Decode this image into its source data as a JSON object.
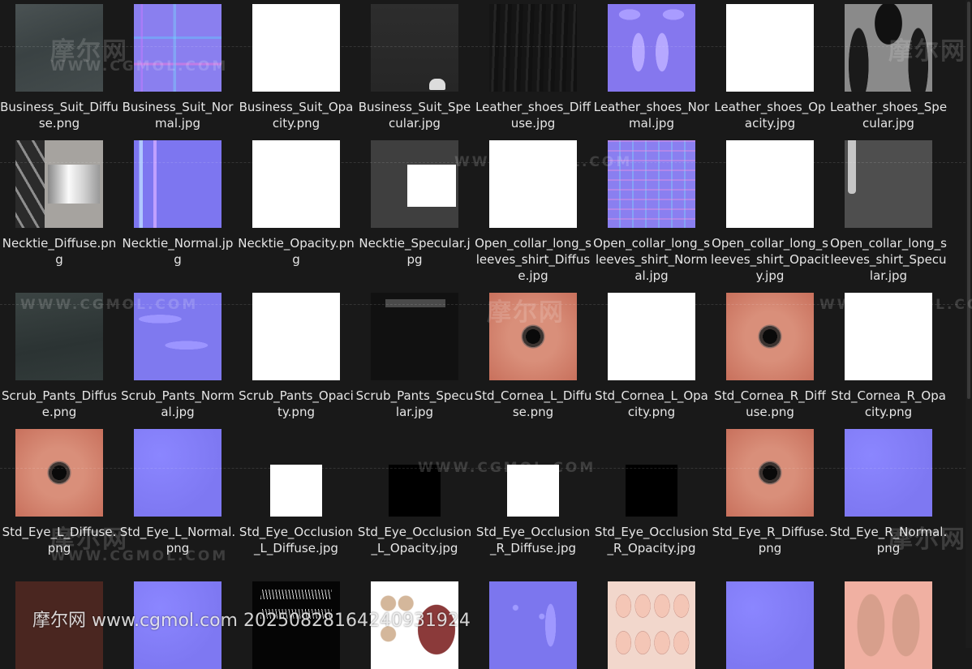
{
  "files": [
    {
      "name": "Business_Suit_Diffuse.png",
      "tex": "t-suit-diffuse",
      "icon": "texture-thumbnail"
    },
    {
      "name": "Business_Suit_Normal.jpg",
      "tex": "t-suit-normal",
      "icon": "texture-thumbnail"
    },
    {
      "name": "Business_Suit_Opacity.png",
      "tex": "t-white",
      "icon": "texture-thumbnail"
    },
    {
      "name": "Business_Suit_Specular.jpg",
      "tex": "t-suit-spec t-spec-dot",
      "icon": "texture-thumbnail"
    },
    {
      "name": "Leather_shoes_Diffuse.jpg",
      "tex": "t-shoe-diffuse",
      "icon": "texture-thumbnail"
    },
    {
      "name": "Leather_shoes_Normal.jpg",
      "tex": "t-shoe-normal",
      "icon": "texture-thumbnail"
    },
    {
      "name": "Leather_shoes_Opacity.jpg",
      "tex": "t-white",
      "icon": "texture-thumbnail"
    },
    {
      "name": "Leather_shoes_Specular.jpg",
      "tex": "t-shoe-spec",
      "icon": "texture-thumbnail"
    },
    {
      "name": "Necktie_Diffuse.png",
      "tex": "t-tie-diffuse",
      "icon": "texture-thumbnail"
    },
    {
      "name": "Necktie_Normal.jpg",
      "tex": "t-tie-normal",
      "icon": "texture-thumbnail"
    },
    {
      "name": "Necktie_Opacity.png",
      "tex": "t-white",
      "icon": "texture-thumbnail"
    },
    {
      "name": "Necktie_Specular.jpg",
      "tex": "t-tie-spec",
      "icon": "texture-thumbnail"
    },
    {
      "name": "Open_collar_long_sleeves_shirt_Diffuse.jpg",
      "tex": "t-white",
      "icon": "texture-thumbnail"
    },
    {
      "name": "Open_collar_long_sleeves_shirt_Normal.jpg",
      "tex": "t-shirt-normal",
      "icon": "texture-thumbnail"
    },
    {
      "name": "Open_collar_long_sleeves_shirt_Opacity.jpg",
      "tex": "t-white",
      "icon": "texture-thumbnail"
    },
    {
      "name": "Open_collar_long_sleeves_shirt_Specular.jpg",
      "tex": "t-shirt-spec",
      "icon": "texture-thumbnail"
    },
    {
      "name": "Scrub_Pants_Diffuse.png",
      "tex": "t-pants-diffuse",
      "icon": "texture-thumbnail"
    },
    {
      "name": "Scrub_Pants_Normal.jpg",
      "tex": "t-pants-normal",
      "icon": "texture-thumbnail"
    },
    {
      "name": "Scrub_Pants_Opacity.png",
      "tex": "t-white",
      "icon": "texture-thumbnail"
    },
    {
      "name": "Scrub_Pants_Specular.jpg",
      "tex": "t-pants-spec",
      "icon": "texture-thumbnail"
    },
    {
      "name": "Std_Cornea_L_Diffuse.png",
      "tex": "t-eye",
      "icon": "texture-thumbnail"
    },
    {
      "name": "Std_Cornea_L_Opacity.png",
      "tex": "t-white",
      "icon": "texture-thumbnail"
    },
    {
      "name": "Std_Cornea_R_Diffuse.png",
      "tex": "t-eye",
      "icon": "texture-thumbnail"
    },
    {
      "name": "Std_Cornea_R_Opacity.png",
      "tex": "t-white",
      "icon": "texture-thumbnail"
    },
    {
      "name": "Std_Eye_L_Diffuse.png",
      "tex": "t-eye",
      "icon": "texture-thumbnail"
    },
    {
      "name": "Std_Eye_L_Normal.png",
      "tex": "t-normal-flat",
      "icon": "texture-thumbnail"
    },
    {
      "name": "Std_Eye_Occlusion_L_Diffuse.jpg",
      "tex": "t-white",
      "icon": "texture-thumbnail",
      "small": true
    },
    {
      "name": "Std_Eye_Occlusion_L_Opacity.jpg",
      "tex": "t-black",
      "icon": "texture-thumbnail",
      "small": true
    },
    {
      "name": "Std_Eye_Occlusion_R_Diffuse.jpg",
      "tex": "t-white",
      "icon": "texture-thumbnail",
      "small": true
    },
    {
      "name": "Std_Eye_Occlusion_R_Opacity.jpg",
      "tex": "t-black",
      "icon": "texture-thumbnail",
      "small": true
    },
    {
      "name": "Std_Eye_R_Diffuse.png",
      "tex": "t-eye",
      "icon": "texture-thumbnail"
    },
    {
      "name": "Std_Eye_R_Normal.png",
      "tex": "t-normal-flat",
      "icon": "texture-thumbnail"
    },
    {
      "name": "",
      "tex": "t-skin-dark",
      "icon": "texture-thumbnail"
    },
    {
      "name": "",
      "tex": "t-normal-flat",
      "icon": "texture-thumbnail"
    },
    {
      "name": "",
      "tex": "t-lash",
      "icon": "texture-thumbnail"
    },
    {
      "name": "",
      "tex": "t-teeth",
      "icon": "texture-thumbnail"
    },
    {
      "name": "",
      "tex": "t-body-normal",
      "icon": "texture-thumbnail"
    },
    {
      "name": "",
      "tex": "t-nails",
      "icon": "texture-thumbnail"
    },
    {
      "name": "",
      "tex": "t-normal-flat",
      "icon": "texture-thumbnail"
    },
    {
      "name": "",
      "tex": "t-body-skin",
      "icon": "texture-thumbnail"
    }
  ],
  "watermark": {
    "cn": "摩尔网",
    "en": "WWW.CGMOL.COM",
    "bottom": "摩尔网 www.cgmol.com 20250828164240931924"
  },
  "colors": {
    "background": "#191919",
    "label_text": "#e6e6e6"
  }
}
